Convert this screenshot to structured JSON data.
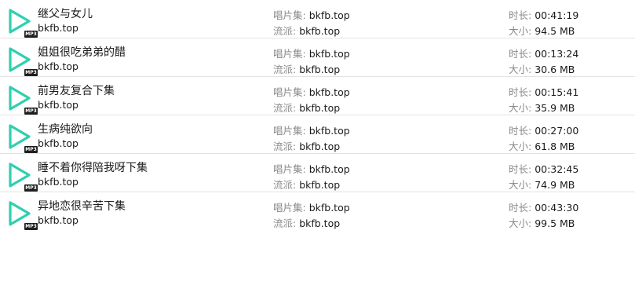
{
  "labels": {
    "album": "唱片集: ",
    "genre": "流派: ",
    "duration": "时长: ",
    "size": "大小: ",
    "badge": "MP3"
  },
  "colors": {
    "play_icon": "#2fcfae",
    "badge_bg": "#1f1f1f",
    "divider": "#e3e3e3"
  },
  "items": [
    {
      "title": "继父与女儿",
      "subtitle": "bkfb.top",
      "album": "bkfb.top",
      "genre": "bkfb.top",
      "duration": "00:41:19",
      "size": "94.5 MB"
    },
    {
      "title": "姐姐很吃弟弟的醋",
      "subtitle": "bkfb.top",
      "album": "bkfb.top",
      "genre": "bkfb.top",
      "duration": "00:13:24",
      "size": "30.6 MB"
    },
    {
      "title": "前男友复合下集",
      "subtitle": "bkfb.top",
      "album": "bkfb.top",
      "genre": "bkfb.top",
      "duration": "00:15:41",
      "size": "35.9 MB"
    },
    {
      "title": "生病纯欲向",
      "subtitle": "bkfb.top",
      "album": "bkfb.top",
      "genre": "bkfb.top",
      "duration": "00:27:00",
      "size": "61.8 MB"
    },
    {
      "title": "睡不着你得陪我呀下集",
      "subtitle": "bkfb.top",
      "album": "bkfb.top",
      "genre": "bkfb.top",
      "duration": "00:32:45",
      "size": "74.9 MB"
    },
    {
      "title": "异地恋很辛苦下集",
      "subtitle": "bkfb.top",
      "album": "bkfb.top",
      "genre": "bkfb.top",
      "duration": "00:43:30",
      "size": "99.5 MB"
    }
  ]
}
